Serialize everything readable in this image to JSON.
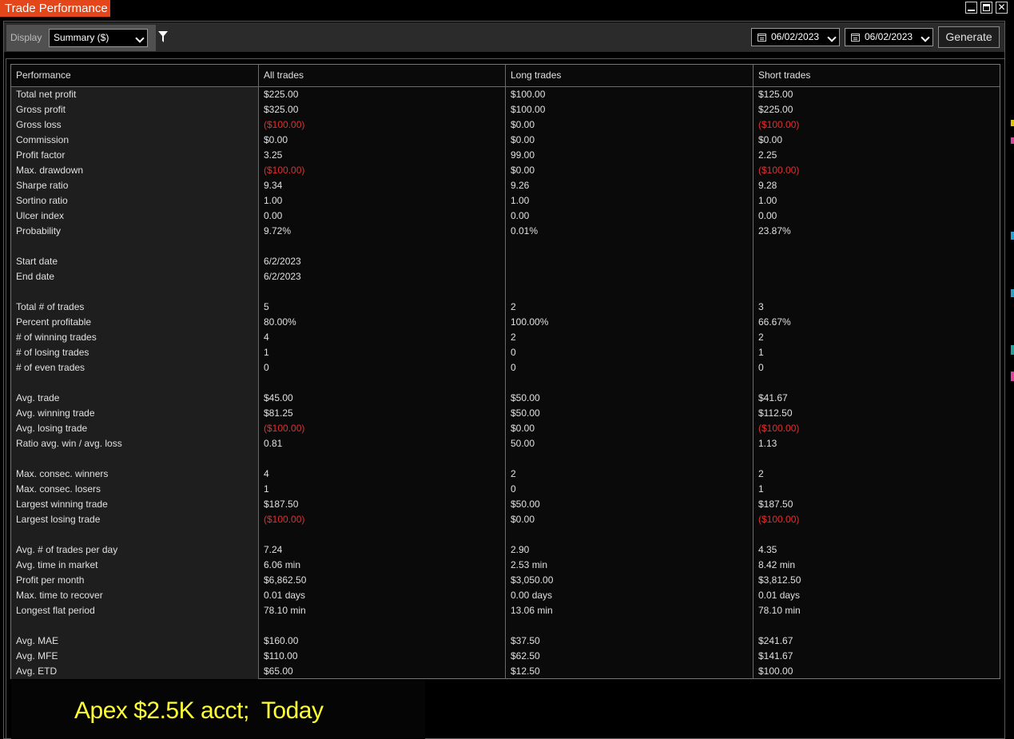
{
  "window": {
    "title": "Trade Performance"
  },
  "toolbar": {
    "display_label": "Display",
    "display_value": "Summary ($)",
    "date_from": "06/02/2023",
    "date_to": "06/02/2023",
    "generate_label": "Generate"
  },
  "table": {
    "headers": [
      "Performance",
      "All trades",
      "Long trades",
      "Short trades"
    ],
    "rows": [
      {
        "label": "Total net profit",
        "all": "$225.00",
        "long": "$100.00",
        "short": "$125.00"
      },
      {
        "label": "Gross profit",
        "all": "$325.00",
        "long": "$100.00",
        "short": "$225.00"
      },
      {
        "label": "Gross loss",
        "all": "($100.00)",
        "long": "$0.00",
        "short": "($100.00)"
      },
      {
        "label": "Commission",
        "all": "$0.00",
        "long": "$0.00",
        "short": "$0.00"
      },
      {
        "label": "Profit factor",
        "all": "3.25",
        "long": "99.00",
        "short": "2.25"
      },
      {
        "label": "Max. drawdown",
        "all": "($100.00)",
        "long": "$0.00",
        "short": "($100.00)"
      },
      {
        "label": "Sharpe ratio",
        "all": "9.34",
        "long": "9.26",
        "short": "9.28"
      },
      {
        "label": "Sortino ratio",
        "all": "1.00",
        "long": "1.00",
        "short": "1.00"
      },
      {
        "label": "Ulcer index",
        "all": "0.00",
        "long": "0.00",
        "short": "0.00"
      },
      {
        "label": "Probability",
        "all": "9.72%",
        "long": "0.01%",
        "short": "23.87%"
      },
      {
        "label": "",
        "all": "",
        "long": "",
        "short": ""
      },
      {
        "label": "Start date",
        "all": "6/2/2023",
        "long": "",
        "short": ""
      },
      {
        "label": "End date",
        "all": "6/2/2023",
        "long": "",
        "short": ""
      },
      {
        "label": "",
        "all": "",
        "long": "",
        "short": ""
      },
      {
        "label": "Total # of trades",
        "all": "5",
        "long": "2",
        "short": "3"
      },
      {
        "label": "Percent profitable",
        "all": "80.00%",
        "long": "100.00%",
        "short": "66.67%"
      },
      {
        "label": "# of winning trades",
        "all": "4",
        "long": "2",
        "short": "2"
      },
      {
        "label": "# of losing trades",
        "all": "1",
        "long": "0",
        "short": "1"
      },
      {
        "label": "# of even trades",
        "all": "0",
        "long": "0",
        "short": "0"
      },
      {
        "label": "",
        "all": "",
        "long": "",
        "short": ""
      },
      {
        "label": "Avg. trade",
        "all": "$45.00",
        "long": "$50.00",
        "short": "$41.67"
      },
      {
        "label": "Avg. winning trade",
        "all": "$81.25",
        "long": "$50.00",
        "short": "$112.50"
      },
      {
        "label": "Avg. losing trade",
        "all": "($100.00)",
        "long": "$0.00",
        "short": "($100.00)"
      },
      {
        "label": "Ratio avg. win / avg. loss",
        "all": "0.81",
        "long": "50.00",
        "short": "1.13"
      },
      {
        "label": "",
        "all": "",
        "long": "",
        "short": ""
      },
      {
        "label": "Max. consec. winners",
        "all": "4",
        "long": "2",
        "short": "2"
      },
      {
        "label": "Max. consec. losers",
        "all": "1",
        "long": "0",
        "short": "1"
      },
      {
        "label": "Largest winning trade",
        "all": "$187.50",
        "long": "$50.00",
        "short": "$187.50"
      },
      {
        "label": "Largest losing trade",
        "all": "($100.00)",
        "long": "$0.00",
        "short": "($100.00)"
      },
      {
        "label": "",
        "all": "",
        "long": "",
        "short": ""
      },
      {
        "label": "Avg. # of trades per day",
        "all": "7.24",
        "long": "2.90",
        "short": "4.35"
      },
      {
        "label": "Avg. time in market",
        "all": "6.06 min",
        "long": "2.53 min",
        "short": "8.42 min"
      },
      {
        "label": "Profit per month",
        "all": "$6,862.50",
        "long": "$3,050.00",
        "short": "$3,812.50"
      },
      {
        "label": "Max. time to recover",
        "all": "0.01 days",
        "long": "0.00 days",
        "short": "0.01 days"
      },
      {
        "label": "Longest flat period",
        "all": "78.10 min",
        "long": "13.06 min",
        "short": "78.10 min"
      },
      {
        "label": "",
        "all": "",
        "long": "",
        "short": ""
      },
      {
        "label": "Avg. MAE",
        "all": "$160.00",
        "long": "$37.50",
        "short": "$241.67"
      },
      {
        "label": "Avg. MFE",
        "all": "$110.00",
        "long": "$62.50",
        "short": "$141.67"
      },
      {
        "label": "Avg. ETD",
        "all": "$65.00",
        "long": "$12.50",
        "short": "$100.00"
      }
    ]
  },
  "overlay": {
    "text": "Apex $2.5K acct;  Today"
  },
  "colors": {
    "accent": "#e2461a",
    "negative": "#e03030",
    "overlay_text": "#ffff33"
  },
  "icons": [
    "minimize-icon",
    "maximize-icon",
    "close-icon",
    "filter-icon",
    "calendar-icon",
    "chevron-down-icon"
  ]
}
